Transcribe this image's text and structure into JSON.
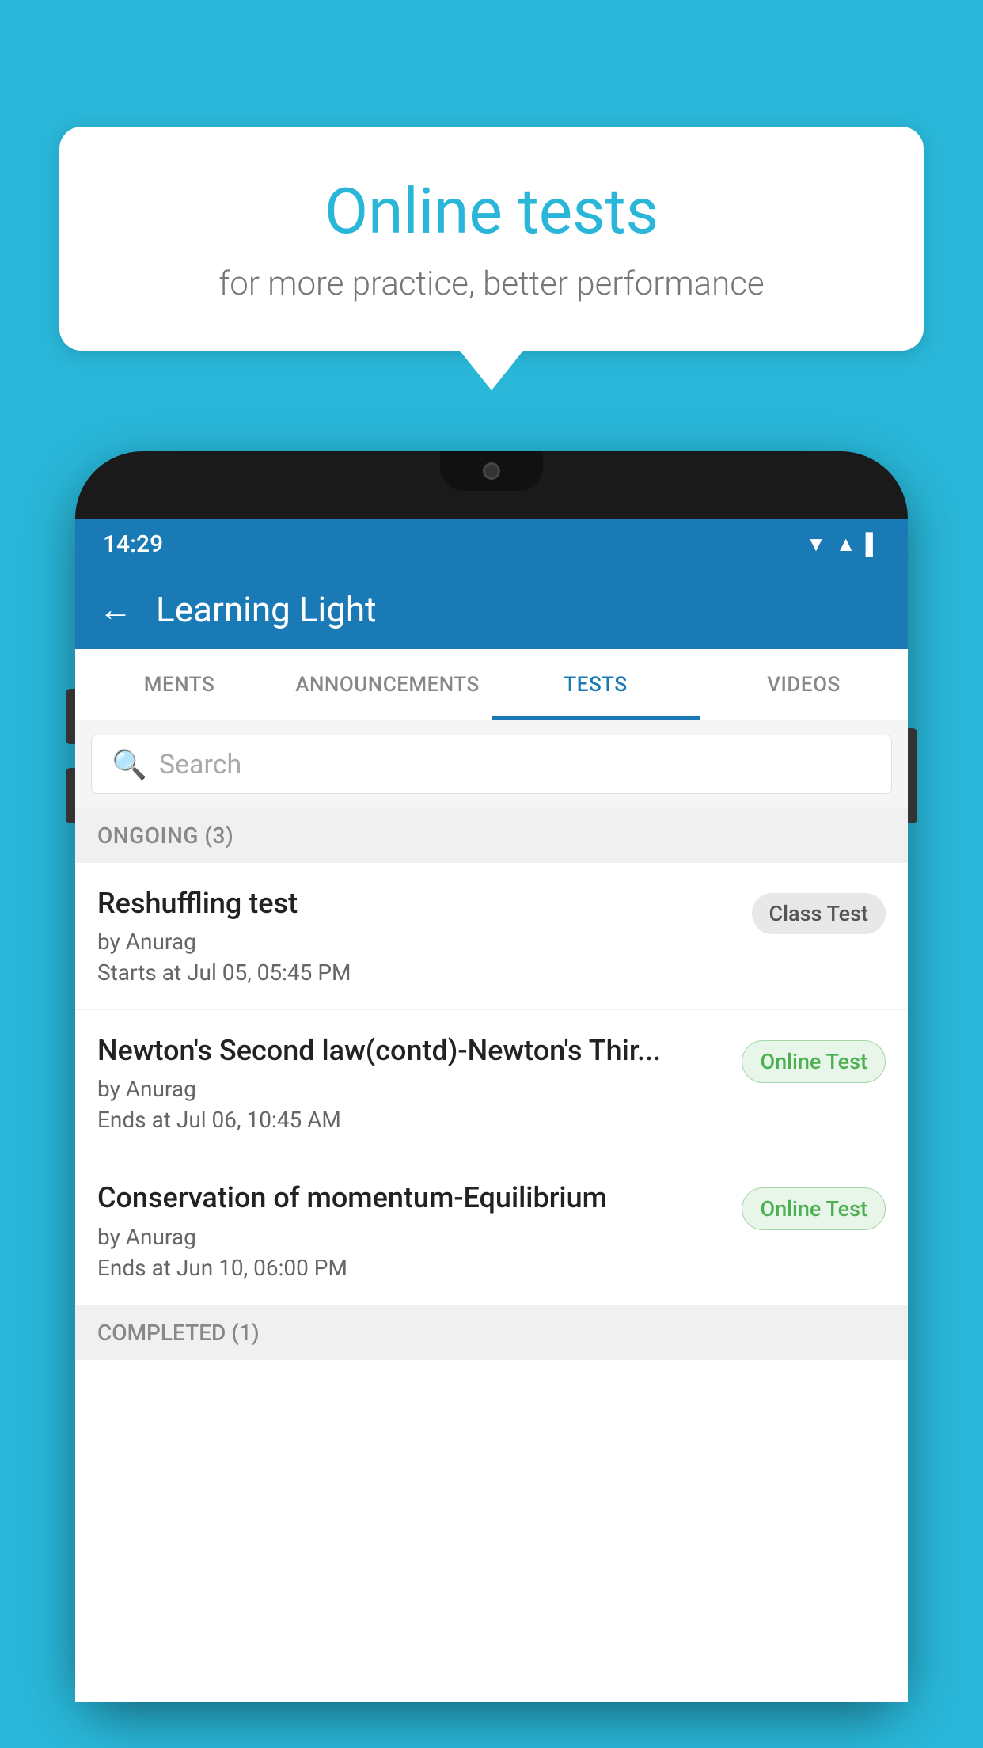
{
  "background_color": "#29b6d8",
  "speech_bubble": {
    "title": "Online tests",
    "subtitle": "for more practice, better performance"
  },
  "phone": {
    "status_bar": {
      "time": "14:29",
      "icons": [
        "wifi",
        "signal",
        "battery"
      ]
    },
    "header": {
      "title": "Learning Light",
      "back_label": "←"
    },
    "tabs": [
      {
        "label": "MENTS",
        "active": false
      },
      {
        "label": "ANNOUNCEMENTS",
        "active": false
      },
      {
        "label": "TESTS",
        "active": true
      },
      {
        "label": "VIDEOS",
        "active": false
      }
    ],
    "search": {
      "placeholder": "Search"
    },
    "sections": [
      {
        "title": "ONGOING (3)",
        "items": [
          {
            "name": "Reshuffling test",
            "author": "by Anurag",
            "date": "Starts at  Jul 05, 05:45 PM",
            "badge": "Class Test",
            "badge_type": "class"
          },
          {
            "name": "Newton's Second law(contd)-Newton's Thir...",
            "author": "by Anurag",
            "date": "Ends at  Jul 06, 10:45 AM",
            "badge": "Online Test",
            "badge_type": "online"
          },
          {
            "name": "Conservation of momentum-Equilibrium",
            "author": "by Anurag",
            "date": "Ends at  Jun 10, 06:00 PM",
            "badge": "Online Test",
            "badge_type": "online"
          }
        ]
      },
      {
        "title": "COMPLETED (1)",
        "items": []
      }
    ]
  }
}
